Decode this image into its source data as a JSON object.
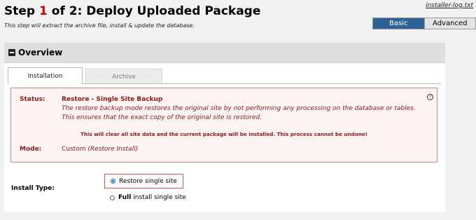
{
  "header": {
    "title_prefix": "Step ",
    "step_current": "1",
    "title_suffix": " of 2: Deploy Uploaded Package",
    "subtitle": "This step will extract the archive file, install & update the database.",
    "log_link": "installer-log.txt"
  },
  "mode_toggle": {
    "basic_label": "Basic",
    "advanced_label": "Advanced",
    "selected": "Basic"
  },
  "overview": {
    "heading": "Overview",
    "tabs": [
      {
        "label": "Installation",
        "active": true
      },
      {
        "label": "Archive",
        "active": false
      }
    ],
    "status": {
      "label": "Status:",
      "title": "Restore - Single Site Backup",
      "description": "The restore backup mode restores the original site by not performing any processing on the database or tables. This ensures that the exact copy of the original site is restored.",
      "warning": "This will clear all site data and the current package will be installed. This process cannot be undone!",
      "mode_label": "Mode:",
      "mode_value": "Custom",
      "mode_detail": "(Restore Install)",
      "help_icon": "?"
    },
    "install_type": {
      "label": "Install Type:",
      "options": [
        {
          "label": "Restore single site",
          "bold_prefix": "",
          "checked": true
        },
        {
          "label": "install single site",
          "bold_prefix": "Full",
          "checked": false
        }
      ]
    }
  },
  "colors": {
    "accent": "#2d6296",
    "step_number": "#cc0000",
    "status_text": "#8b1a1a",
    "highlight_border": "#d9534f"
  }
}
